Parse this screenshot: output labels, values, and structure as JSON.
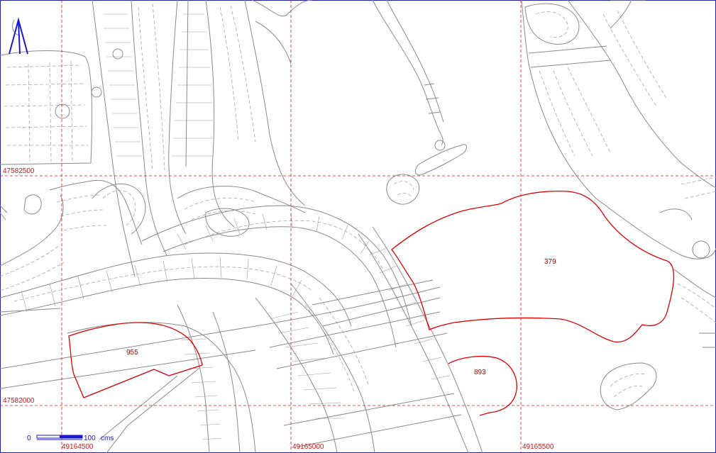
{
  "map": {
    "north_arrow_icon": "north-arrow-icon",
    "coordinate_labels": {
      "y_upper": "47582500",
      "y_lower": "47582000",
      "x_left": "49164500",
      "x_mid": "49165000",
      "x_right": "49165500"
    },
    "parcels": [
      {
        "id": "379"
      },
      {
        "id": "955"
      },
      {
        "id": "893"
      }
    ],
    "scale_bar": {
      "start": "0",
      "end": "100",
      "unit": "cms"
    },
    "colors": {
      "grid": "#d01818",
      "parcel_outline": "#e00000",
      "base_lines": "#8a8a8a",
      "north_arrow": "#1a1acc",
      "scale_bar": "#1a1acc"
    }
  }
}
